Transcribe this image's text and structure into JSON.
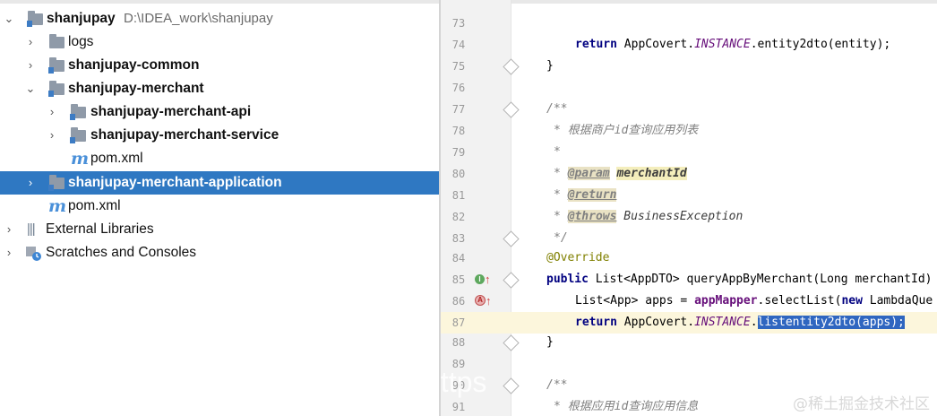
{
  "project_tree": {
    "root": {
      "name": "shanjupay",
      "path": "D:\\IDEA_work\\shanjupay"
    },
    "items": [
      {
        "label": "logs"
      },
      {
        "label": "shanjupay-common"
      },
      {
        "label": "shanjupay-merchant"
      },
      {
        "label": "shanjupay-merchant-api"
      },
      {
        "label": "shanjupay-merchant-service"
      },
      {
        "label": "pom.xml"
      },
      {
        "label": "shanjupay-merchant-application"
      },
      {
        "label": "pom.xml"
      },
      {
        "label": "External Libraries"
      },
      {
        "label": "Scratches and Consoles"
      }
    ],
    "icons": {
      "maven": "m"
    }
  },
  "editor": {
    "line_numbers": [
      "73",
      "74",
      "75",
      "76",
      "77",
      "78",
      "79",
      "80",
      "81",
      "82",
      "83",
      "84",
      "85",
      "86",
      "87",
      "88",
      "89",
      "90",
      "91"
    ],
    "code": {
      "l74": {
        "kw": "return",
        "pre": " AppCovert.",
        "inst": "INSTANCE",
        "post": ".entity2dto(entity);"
      },
      "l75": "}",
      "l77": "/**",
      "l78": "* 根据商户id查询应用列表",
      "l79": "*",
      "l80": {
        "star": "* ",
        "tag": "@param",
        "name": "merchantId"
      },
      "l81": {
        "star": "* ",
        "tag": "@return"
      },
      "l82": {
        "star": "* ",
        "tag": "@throws",
        "rest": " BusinessException"
      },
      "l83": "*/",
      "l84": "@Override",
      "l85": {
        "kw": "public",
        "rest": " List<AppDTO> queryAppByMerchant(Long merchantId)"
      },
      "l86": {
        "pre": "List<App> apps = ",
        "field": "appMapper",
        "mid": ".selectList(",
        "kw": "new",
        "rest": " LambdaQue"
      },
      "l87": {
        "kw": "return",
        "pre": " AppCovert.",
        "inst": "INSTANCE",
        "dot": ".",
        "selected": "listentity2dto(apps);"
      },
      "l88": "}",
      "l90": "/**",
      "l91": "* 根据应用id查询应用信息"
    },
    "gutter_badges": {
      "l85": "I",
      "l86": "A",
      "arrow": "↑"
    }
  },
  "watermark": {
    "left": "https",
    "right": "@稀土掘金技术社区"
  }
}
